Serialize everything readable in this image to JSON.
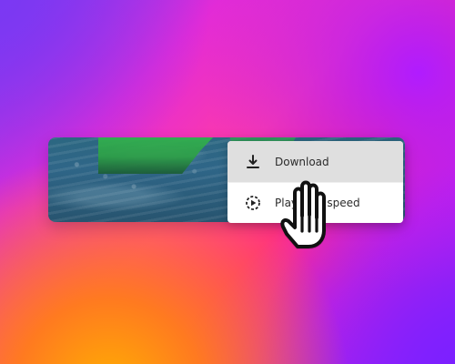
{
  "menu": {
    "items": [
      {
        "label": "Download",
        "icon": "download-icon",
        "active": true
      },
      {
        "label": "Playback speed",
        "icon": "playback-speed-icon",
        "active": false
      }
    ]
  },
  "colors": {
    "background_top": "#8038f0",
    "background_mid": "#ff2d89",
    "background_bottom": "#ff7a20",
    "menu_background": "#ffffff",
    "menu_active_background": "#dfdfdf",
    "menu_text": "#2b2b2b",
    "video_water": "#2f6688",
    "video_green": "#2e9f48"
  },
  "cursor": {
    "icon": "hand-cursor-icon"
  }
}
